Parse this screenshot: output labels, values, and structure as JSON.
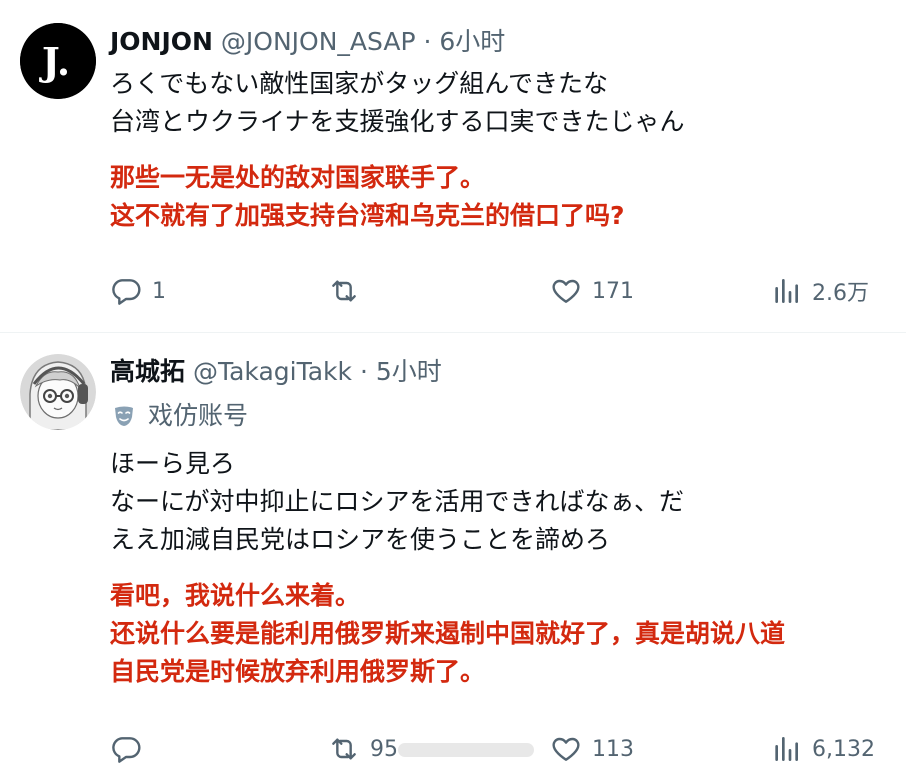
{
  "tweets": [
    {
      "display_name": "JONJON",
      "handle": "@JONJON_ASAP",
      "separator": "·",
      "time": "6小时",
      "avatar_letter": "J.",
      "body_jp": [
        "ろくでもない敵性国家がタッグ組んできたな",
        "台湾とウクライナを支援強化する口実できたじゃん"
      ],
      "body_cn": [
        "那些一无是处的敌对国家联手了。",
        "这不就有了加强支持台湾和乌克兰的借口了吗?"
      ],
      "actions": {
        "reply_count": "1",
        "retweet_count": "",
        "like_count": "171",
        "views_count": "2.6万"
      }
    },
    {
      "display_name": "高城拓",
      "handle": "@TakagiTakk",
      "separator": "·",
      "time": "5小时",
      "parody_label": "戏仿账号",
      "body_jp": [
        "ほーら見ろ",
        "なーにが対中抑止にロシアを活用できればなぁ、だ",
        "ええ加減自民党はロシアを使うことを諦めろ"
      ],
      "body_cn": [
        "看吧，我说什么来着。",
        "还说什么要是能利用俄罗斯来遏制中国就好了，真是胡说八道",
        "自民党是时候放弃利用俄罗斯了。"
      ],
      "actions": {
        "reply_count": "",
        "retweet_count": "95",
        "like_count": "113",
        "views_count": "6,132"
      }
    }
  ],
  "colors": {
    "translation_red": "#d3290f",
    "secondary_gray": "#536471",
    "divider": "#eff3f4"
  },
  "icons": [
    "reply-icon",
    "retweet-icon",
    "like-icon",
    "views-icon",
    "parody-mask-icon"
  ]
}
